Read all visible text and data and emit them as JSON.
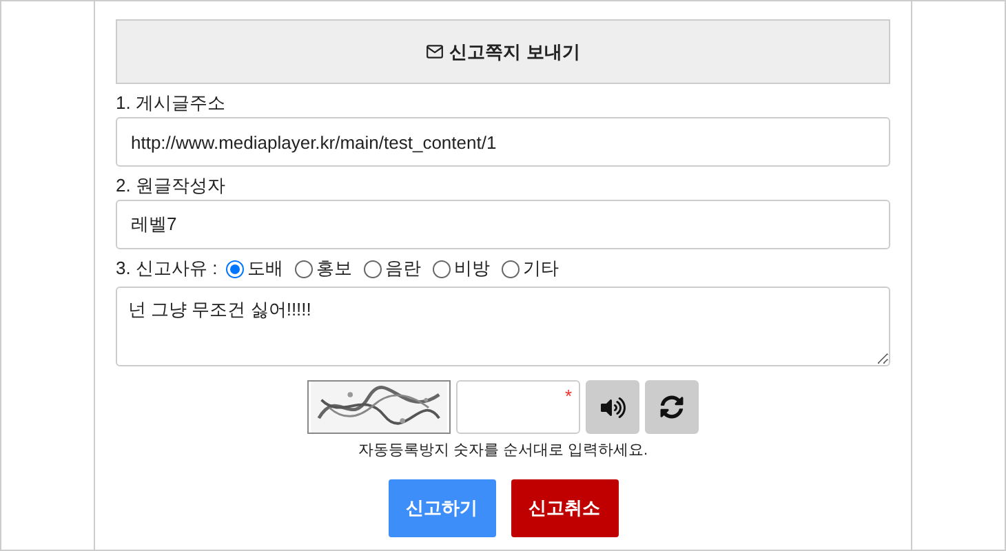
{
  "header": {
    "title": "신고쪽지 보내기"
  },
  "fields": [
    {
      "label": "1. 게시글주소",
      "value": "http://www.mediaplayer.kr/main/test_content/1"
    },
    {
      "label": "2. 원글작성자",
      "value": "레벨7"
    }
  ],
  "reason": {
    "label": "3. 신고사유 :",
    "options": [
      {
        "label": "도배",
        "selected": true
      },
      {
        "label": "홍보",
        "selected": false
      },
      {
        "label": "음란",
        "selected": false
      },
      {
        "label": "비방",
        "selected": false
      },
      {
        "label": "기타",
        "selected": false
      }
    ]
  },
  "message": {
    "value": "넌 그냥 무조건 싫어!!!!!"
  },
  "captcha": {
    "required_mark": "*",
    "hint": "자동등록방지 숫자를 순서대로 입력하세요."
  },
  "buttons": [
    {
      "label": "신고하기",
      "kind": "submit"
    },
    {
      "label": "신고취소",
      "kind": "cancel"
    }
  ]
}
